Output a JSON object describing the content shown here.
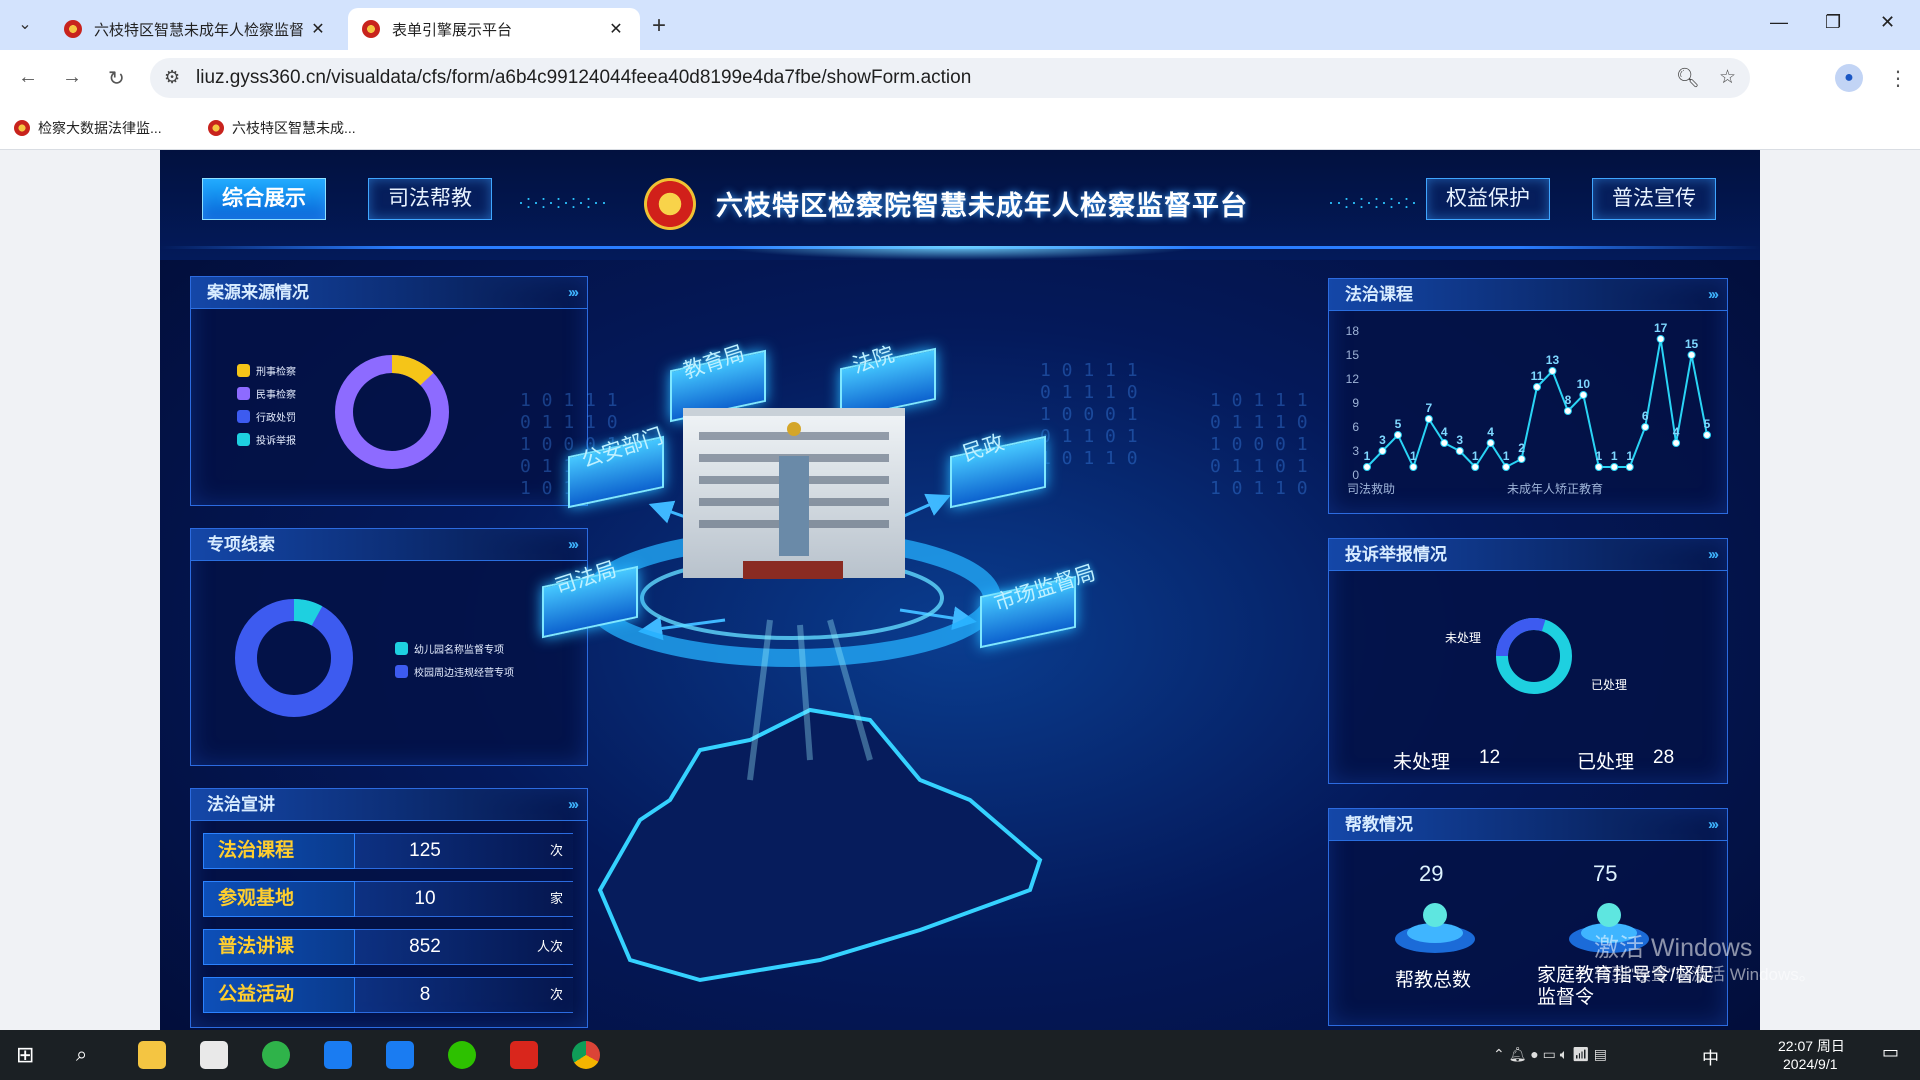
{
  "browser": {
    "tabs": [
      {
        "title": "六枝特区智慧未成年人检察监督",
        "close": "✕"
      },
      {
        "title": "表单引擎展示平台",
        "close": "✕"
      }
    ],
    "new_tab": "+",
    "url": "liuz.gyss360.cn/visualdata/cfs/form/a6b4c99124044feea40d8199e4da7fbe/showForm.action",
    "bookmarks": [
      "检察大数据法律监...",
      "六枝特区智慧未成..."
    ]
  },
  "dashboard": {
    "title": "六枝特区检察院智慧未成年人检察监督平台",
    "nav_left": [
      "综合展示",
      "司法帮教"
    ],
    "nav_right": [
      "权益保护",
      "普法宣传"
    ],
    "arrows": "›››",
    "case_source": {
      "title": "案源来源情况",
      "legend": [
        {
          "label": "刑事检察",
          "color": "#f5c518"
        },
        {
          "label": "民事检察",
          "color": "#8d6bff"
        },
        {
          "label": "行政处罚",
          "color": "#3d5bf0"
        },
        {
          "label": "投诉举报",
          "color": "#1ed0e0"
        }
      ],
      "slices": [
        {
          "label": "刑事检察",
          "pct": 0.13
        },
        {
          "label": "民事检察",
          "pct": 0.87
        }
      ]
    },
    "special_clues": {
      "title": "专项线索",
      "legend": [
        {
          "label": "幼儿园名称监督专项",
          "color": "#1ed0e0"
        },
        {
          "label": "校园周边违规经营专项",
          "color": "#3d5bf0"
        }
      ],
      "slices": [
        {
          "label": "幼儿园名称监督专项",
          "pct": 0.08
        },
        {
          "label": "校园周边违规经营专项",
          "pct": 0.92
        }
      ]
    },
    "legal_lecture": {
      "title": "法治宣讲",
      "rows": [
        {
          "label": "法治课程",
          "value": "125",
          "unit": "次"
        },
        {
          "label": "参观基地",
          "value": "10",
          "unit": "家"
        },
        {
          "label": "普法讲课",
          "value": "852",
          "unit": "人次"
        },
        {
          "label": "公益活动",
          "value": "8",
          "unit": "次"
        }
      ]
    },
    "center_nodes": [
      "教育局",
      "法院",
      "公安部门",
      "民政",
      "司法局",
      "市场监督局"
    ],
    "binary_text": "1 0 1 1 1\n0 1 1 1 0\n1 0 0 0 1\n0 1 1 0 1\n1 0 1 1 0",
    "legal_course": {
      "title": "法治课程",
      "x_labels": [
        "司法救助",
        "未成年人矫正教育"
      ],
      "y_ticks": [
        "18",
        "15",
        "12",
        "9",
        "6",
        "3",
        "0"
      ]
    },
    "complaints": {
      "title": "投诉举报情况",
      "label_unprocessed": "未处理",
      "label_processed": "已处理",
      "unprocessed": "12",
      "processed": "28"
    },
    "help_edu": {
      "title": "帮教情况",
      "items": [
        {
          "value": "29",
          "label": "帮教总数"
        },
        {
          "value": "75",
          "label": "家庭教育指导令/督促监督令"
        }
      ]
    },
    "colors": {
      "accent": "#2aa8ff",
      "gold": "#ffce2e",
      "bg": "#04195a"
    }
  },
  "chart_data": {
    "type": "line",
    "values": [
      1,
      3,
      5,
      1,
      7,
      4,
      3,
      1,
      4,
      1,
      2,
      11,
      13,
      8,
      10,
      1,
      1,
      1,
      6,
      17,
      4,
      15,
      5
    ],
    "ylim": [
      0,
      18
    ],
    "yticks": [
      0,
      3,
      6,
      9,
      12,
      15,
      18
    ],
    "xlabel_groups": [
      "司法救助",
      "未成年人矫正教育"
    ],
    "grid": false
  },
  "windows": {
    "activate_line1": "激活 Windows",
    "activate_line2": "转到\"设置\"以激活 Windows。"
  },
  "taskbar": {
    "time": "22:07 周日",
    "date": "2024/9/1",
    "ime": "中"
  }
}
